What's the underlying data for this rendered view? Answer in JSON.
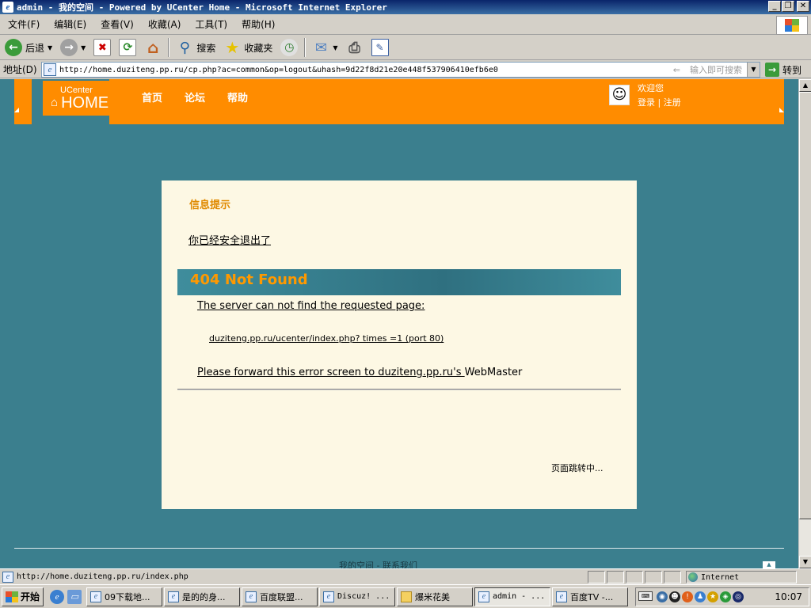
{
  "window": {
    "title": "admin - 我的空间 - Powered by UCenter Home - Microsoft Internet Explorer",
    "min_label": "_",
    "max_label": "❐",
    "close_label": "✕"
  },
  "menu": [
    "文件(F)",
    "编辑(E)",
    "查看(V)",
    "收藏(A)",
    "工具(T)",
    "帮助(H)"
  ],
  "toolbar": {
    "back": "后退",
    "search": "搜索",
    "favorites": "收藏夹"
  },
  "address": {
    "label": "地址(D)",
    "url": "http://home.duziteng.pp.ru/cp.php?ac=common&op=logout&uhash=9d22f8d21e20e448f537906410efb6e0",
    "hint": "输入即可搜索",
    "hint_arrow": "⇐",
    "go": "转到"
  },
  "site": {
    "logo_small": "UCenter",
    "logo_big": "HOME",
    "nav": [
      "首页",
      "论坛",
      "帮助"
    ],
    "welcome": "欢迎您",
    "login": "登录",
    "sep": "|",
    "register": "注册"
  },
  "message": {
    "title": "信息提示",
    "text": "你已经安全退出了 ",
    "error_title": "404 Not Found",
    "error_line1": "The server can not find the requested page:",
    "error_line2": "duziteng.pp.ru/ucenter/index.php?    times    =1 (port 80)",
    "error_line3_link": "Please forward this error screen to duziteng.pp.ru's ",
    "error_line3_tail": "WebMaster",
    "redirect": "页面跳转中..."
  },
  "footer": {
    "text": "我的空间 - 联系我们"
  },
  "status": {
    "url": "http://home.duziteng.pp.ru/index.php",
    "zone": "Internet"
  },
  "taskbar": {
    "start": "开始",
    "tasks": [
      {
        "label": "09下载地...",
        "mono": false,
        "folder": false,
        "active": false
      },
      {
        "label": "是的的身...",
        "mono": false,
        "folder": false,
        "active": false
      },
      {
        "label": "百度联盟...",
        "mono": false,
        "folder": false,
        "active": false
      },
      {
        "label": "Discuz! ...",
        "mono": true,
        "folder": false,
        "active": false
      },
      {
        "label": "爆米花美",
        "mono": false,
        "folder": true,
        "active": false
      },
      {
        "label": "admin - ...",
        "mono": true,
        "folder": false,
        "active": true
      },
      {
        "label": "百度TV -...",
        "mono": false,
        "folder": false,
        "active": false
      }
    ],
    "clock": "10:07"
  },
  "colors": {
    "page_bg": "#3b7f8e",
    "header_orange": "#ff8c00",
    "panel_bg": "#fdf8e4",
    "error_title": "#ff9900"
  }
}
